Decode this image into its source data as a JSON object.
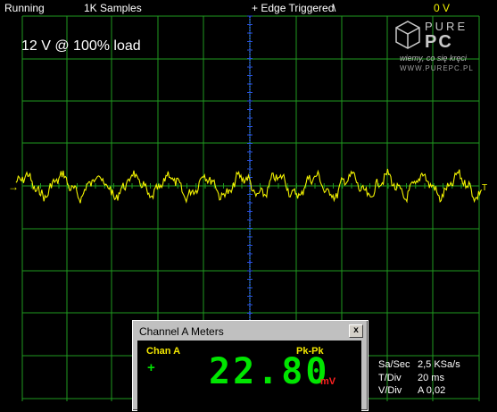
{
  "status_bar": {
    "run_state": "Running",
    "samples": "1K Samples",
    "trigger": "+ Edge Triggered",
    "trigger_slope_symbol": "\\",
    "channel_offset": "0 V"
  },
  "annotation": "12 V @ 100% load",
  "logo": {
    "brand_top": "PURE",
    "brand_bottom": "PC",
    "tagline": "wiemy, co się kręci",
    "site": "WWW.PUREPC.PL"
  },
  "markers": {
    "left_arrow": "→",
    "right_label": "T"
  },
  "meters_window": {
    "title": "Channel A Meters",
    "close_symbol": "x",
    "channel": "Chan A",
    "measurement": "Pk-Pk",
    "sign": "+",
    "reading": "22.80",
    "unit": "mV"
  },
  "timebase_info": {
    "sa_sec_label": "Sa/Sec",
    "sa_sec_value": "2,5 KSa/s",
    "t_div_label": "T/Div",
    "t_div_value": "20 ms",
    "v_div_label": "V/Div",
    "v_div_value": "A 0,02"
  },
  "colors": {
    "background": "#000000",
    "grid": "#1f9a1f",
    "trace": "#f2f200",
    "trigger_line": "#2a4fe0",
    "digits": "#00e500",
    "unit": "#ff2020"
  }
}
